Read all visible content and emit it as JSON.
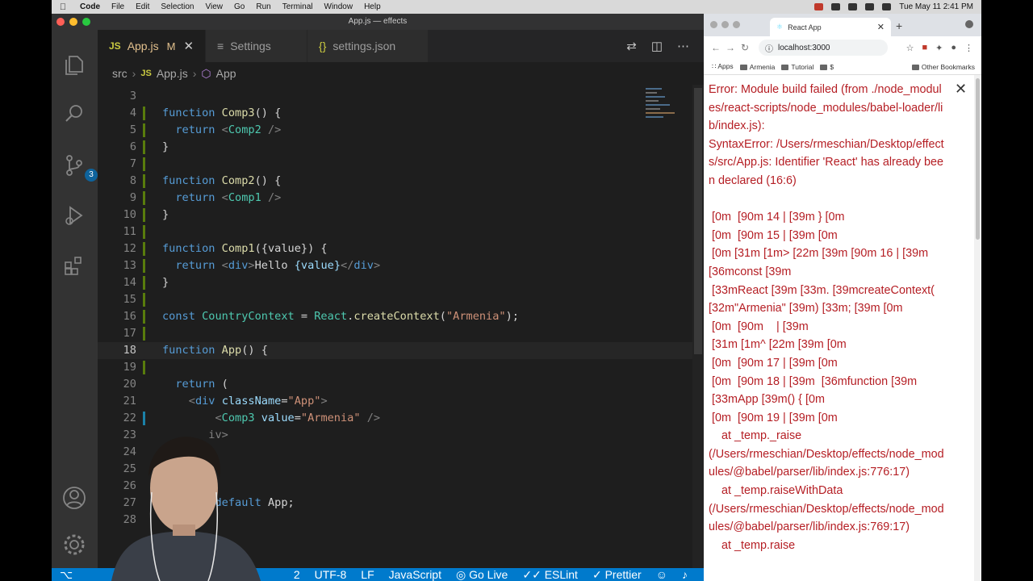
{
  "menubar": {
    "app_name": "Code",
    "items": [
      "File",
      "Edit",
      "Selection",
      "View",
      "Go",
      "Run",
      "Terminal",
      "Window",
      "Help"
    ],
    "clock": "Tue May 11  2:41 PM"
  },
  "vscode": {
    "window_title": "App.js — effects",
    "tabs": [
      {
        "label": "App.js",
        "prefix": "JS",
        "modified": "M"
      },
      {
        "label": "Settings"
      },
      {
        "label": "settings.json",
        "prefix": "{}"
      }
    ],
    "breadcrumb": {
      "folder": "src",
      "file": "App.js",
      "symbol": "App"
    },
    "scm_badge": "3",
    "status": {
      "problems": "2",
      "encoding": "UTF-8",
      "eol": "LF",
      "language": "JavaScript",
      "go_live": "Go Live",
      "eslint": "ESLint",
      "prettier": "Prettier"
    },
    "lines": [
      "3",
      "4",
      "5",
      "6",
      "7",
      "8",
      "9",
      "10",
      "11",
      "12",
      "13",
      "14",
      "15",
      "16",
      "17",
      "18",
      "19",
      "20",
      "21",
      "22",
      "23",
      "24",
      "25",
      "26",
      "27",
      "28"
    ],
    "code": {
      "l4": {
        "kw": "function",
        "name": "Comp3",
        "rest": "() {"
      },
      "l5": {
        "kw": "return",
        "tag": "Comp2"
      },
      "l8": {
        "kw": "function",
        "name": "Comp2",
        "rest": "() {"
      },
      "l9": {
        "kw": "return",
        "tag": "Comp1"
      },
      "l12": {
        "kw": "function",
        "name": "Comp1",
        "rest": "({value}) {"
      },
      "l13": {
        "kw": "return",
        "div": "div",
        "text": "Hello ",
        "expr": "{value}"
      },
      "l16": {
        "kw": "const",
        "name": "CountryContext",
        "obj": "React",
        "method": "createContext",
        "arg": "\"Armenia\""
      },
      "l18": {
        "kw": "function",
        "name": "App",
        "rest": "() {"
      },
      "l20": {
        "kw": "return",
        "rest": " ("
      },
      "l21": {
        "tag": "div",
        "attr": "className",
        "val": "\"App\""
      },
      "l22": {
        "tag": "Comp3",
        "attr": "value",
        "val": "\"Armenia\""
      },
      "l23": {
        "tag": "iv"
      },
      "l27": {
        "kw": "default",
        "name": "App"
      }
    }
  },
  "chrome": {
    "tab_title": "React App",
    "url": "localhost:3000",
    "bookmarks": [
      "Apps",
      "Armenia",
      "Tutorial",
      "$"
    ],
    "other_bookmarks": "Other Bookmarks",
    "error_text": "Error: Module build failed (from ./node_modules/react-scripts/node_modules/babel-loader/lib/index.js):\nSyntaxError: /Users/rmeschian/Desktop/effects/src/App.js: Identifier 'React' has already been declared (16:6)\n\n [0m  [90m 14 | [39m } [0m\n [0m  [90m 15 | [39m [0m\n [0m [31m [1m> [22m [39m [90m 16 | [39m  [36mconst [39m\n [33mReact [39m [33m. [39mcreateContext( [32m\"Armenia\" [39m) [33m; [39m [0m\n [0m  [90m    | [39m\n [31m [1m^ [22m [39m [0m\n [0m  [90m 17 | [39m [0m\n [0m  [90m 18 | [39m  [36mfunction [39m\n [33mApp [39m() { [0m\n [0m  [90m 19 | [39m [0m\n    at _temp._raise\n(/Users/rmeschian/Desktop/effects/node_modules/@babel/parser/lib/index.js:776:17)\n    at _temp.raiseWithData\n(/Users/rmeschian/Desktop/effects/node_modules/@babel/parser/lib/index.js:769:17)\n    at _temp.raise"
  },
  "colors": {
    "status_bar": "#007acc",
    "error_text": "#b51e24",
    "editor_bg": "#1e1e1e"
  }
}
